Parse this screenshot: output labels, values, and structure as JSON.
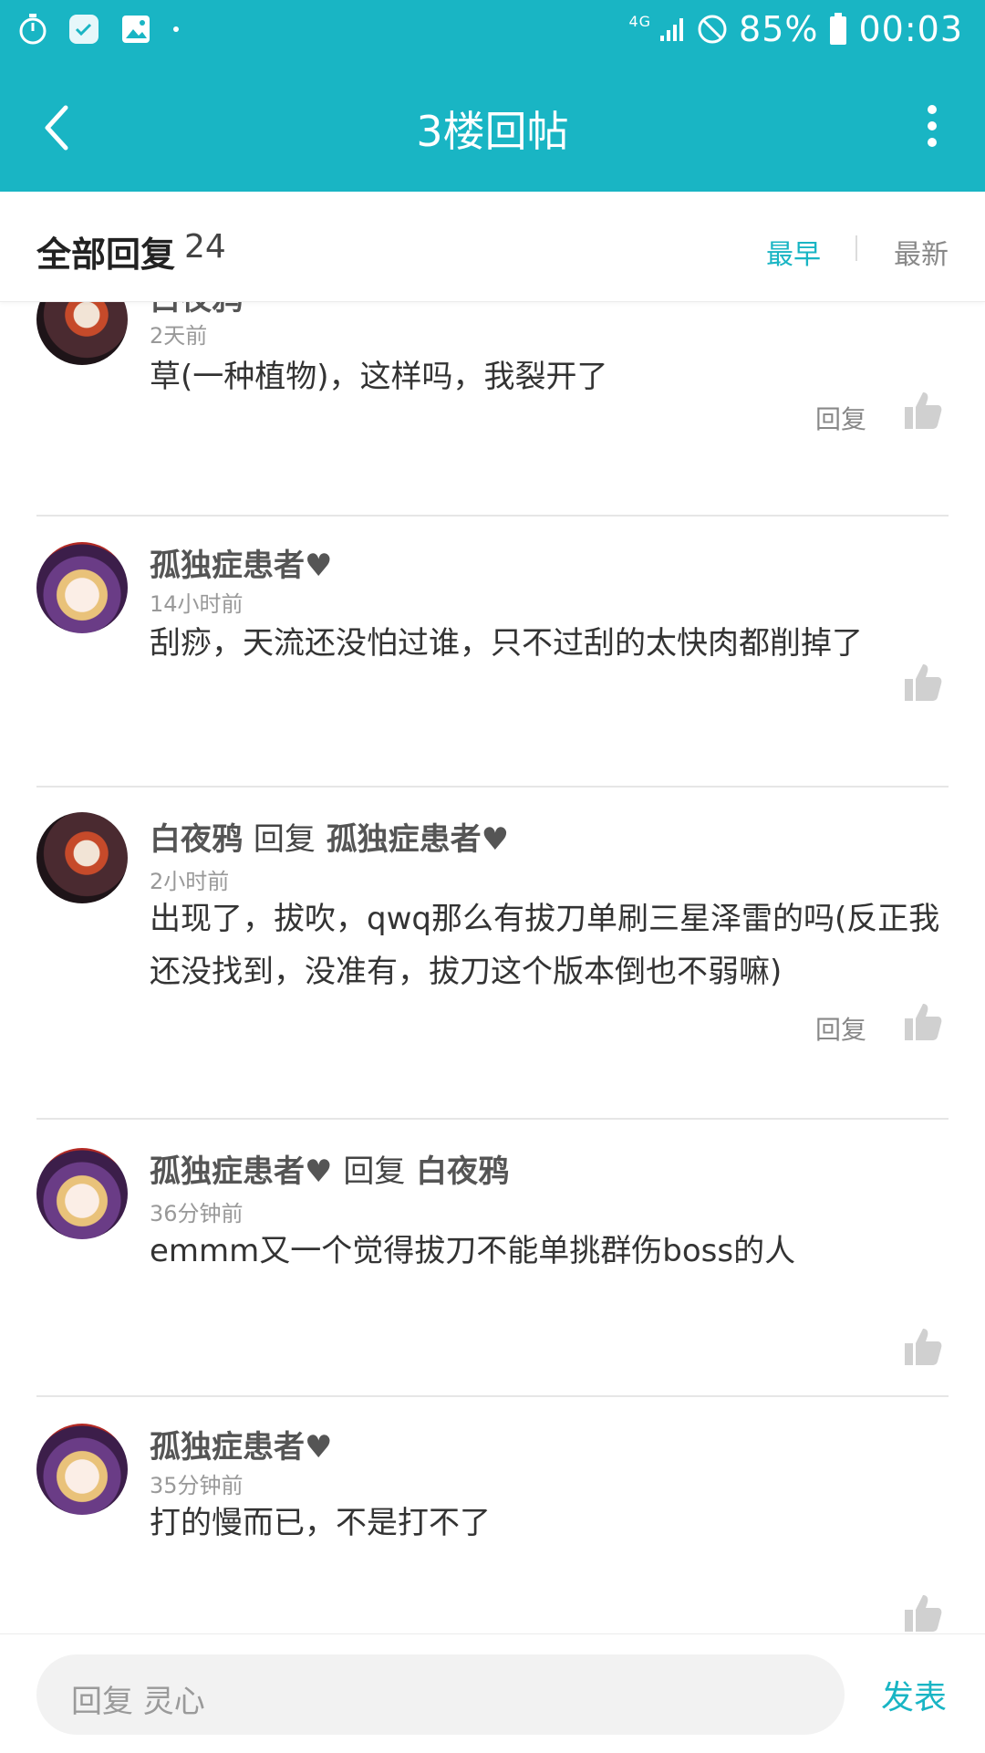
{
  "status_bar": {
    "network": "4G",
    "battery": "85%",
    "time": "00:03",
    "icons": [
      "timer-icon",
      "chat-icon",
      "image-icon",
      "dot-icon",
      "signal-icon",
      "do-not-disturb-icon",
      "battery-icon"
    ]
  },
  "app_bar": {
    "title": "3楼回帖",
    "back_icon": "chevron-left-icon",
    "more_icon": "more-vertical-icon"
  },
  "filter": {
    "title": "全部回复",
    "count": "24",
    "earliest": "最早",
    "newest": "最新",
    "active": "最早"
  },
  "comments": [
    {
      "name": "白夜鸦",
      "time": "2天前",
      "content": "草(一种植物)，这样吗，我裂开了",
      "reply_label": "回复"
    },
    {
      "name": "孤独症患者♥",
      "time": "14小时前",
      "content": "刮痧，天流还没怕过谁，只不过刮的太快肉都削掉了"
    },
    {
      "name": "白夜鸦",
      "reply_word": "回复",
      "reply_to": "孤独症患者♥",
      "time": "2小时前",
      "content": "出现了，拔吹，qwq那么有拔刀单刷三星泽雷的吗(反正我还没找到，没准有，拔刀这个版本倒也不弱嘛)",
      "reply_label": "回复"
    },
    {
      "name": "孤独症患者♥",
      "reply_word": "回复",
      "reply_to": "白夜鸦",
      "time": "36分钟前",
      "content": "emmm又一个觉得拔刀不能单挑群伤boss的人"
    },
    {
      "name": "孤独症患者♥",
      "time": "35分钟前",
      "content": "打的慢而已，不是打不了"
    }
  ],
  "bottom_bar": {
    "placeholder": "回复 灵心",
    "send": "发表"
  },
  "colors": {
    "accent": "#19b5c4"
  }
}
